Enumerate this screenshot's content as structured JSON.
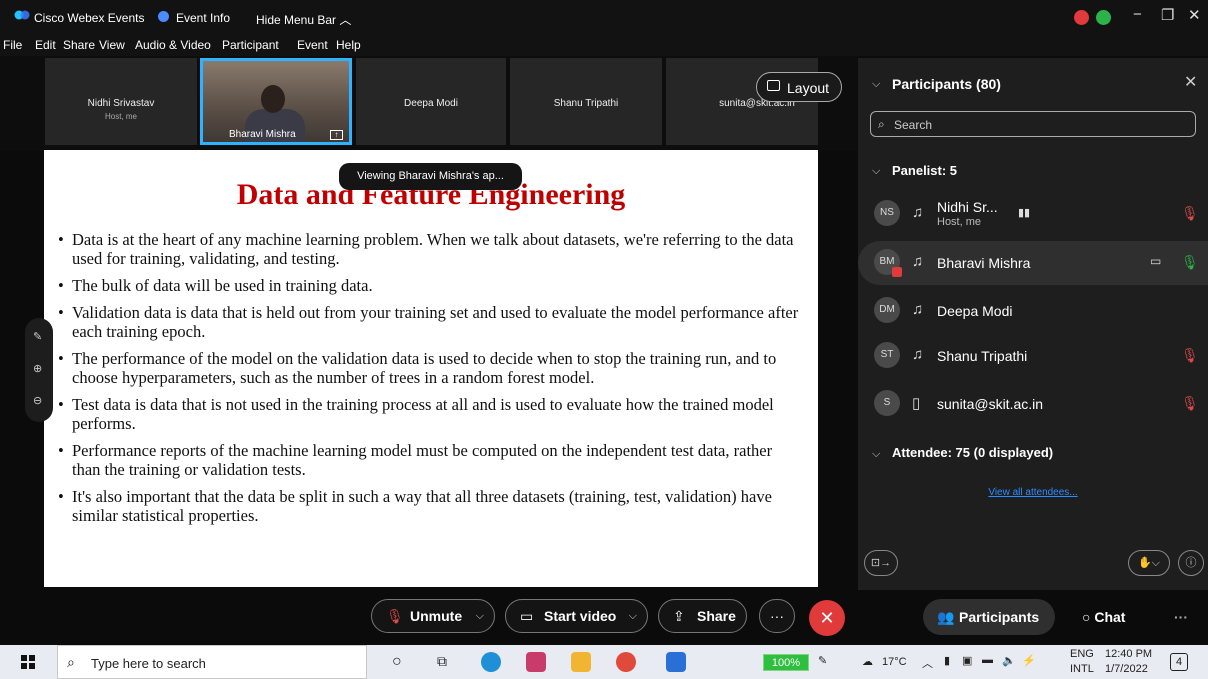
{
  "titlebar": {
    "app_name": "Cisco Webex Events",
    "event_info": "Event Info",
    "hide_menu": "Hide Menu Bar ︿",
    "minimize": "−",
    "restore": "❐",
    "close": "✕"
  },
  "menu": [
    "File",
    "Edit",
    "Share",
    "View",
    "Audio & Video",
    "Participant",
    "Event",
    "Help"
  ],
  "strip": {
    "tiles": [
      {
        "name": "Nidhi Srivastav",
        "sub": "Host, me"
      },
      {
        "name": "Bharavi Mishra",
        "sub": ""
      },
      {
        "name": "Deepa Modi",
        "sub": ""
      },
      {
        "name": "Shanu Tripathi",
        "sub": ""
      },
      {
        "name": "sunita@skit.ac.in",
        "sub": ""
      }
    ],
    "layout_label": "Layout"
  },
  "toast": "Viewing Bharavi Mishra's ap...",
  "slide": {
    "title": "Data and Feature Engineering",
    "bullets": [
      "Data is at the heart of any machine learning problem. When we talk about datasets, we're referring to the data used for training, validating, and testing.",
      "The bulk of data will be used in training data.",
      "Validation data is data that is held out from your training set and used to evaluate the model performance after each training epoch.",
      "The performance of the model on the validation data is used to decide when to stop the training run, and to choose hyperparameters, such as the number of trees in a random forest model.",
      "Test data is data that is not used in the training process at all and is used to evaluate how the trained model performs.",
      "Performance reports of the machine learning model must be computed on the independent test data, rather than the training or validation tests.",
      "It's also important that the data be split in such a way that all three datasets (training, test, validation) have similar statistical properties."
    ]
  },
  "panel": {
    "title": "Participants (80)",
    "search_placeholder": "Search",
    "panelist_header": "Panelist: 5",
    "panelists": [
      {
        "initials": "NS",
        "name": "Nidhi Sr...",
        "role": "Host, me"
      },
      {
        "initials": "BM",
        "name": "Bharavi Mishra",
        "role": ""
      },
      {
        "initials": "DM",
        "name": "Deepa Modi",
        "role": ""
      },
      {
        "initials": "ST",
        "name": "Shanu Tripathi",
        "role": ""
      },
      {
        "initials": "S",
        "name": "sunita@skit.ac.in",
        "role": ""
      }
    ],
    "attendee_header": "Attendee: 75 (0 displayed)",
    "view_all": "View all attendees..."
  },
  "controls": {
    "unmute": "Unmute",
    "start_video": "Start video",
    "share": "Share",
    "more": "···",
    "participants": "Participants",
    "chat": "Chat"
  },
  "taskbar": {
    "search_placeholder": "Type here to search",
    "battery": "100%",
    "temperature": "17°C",
    "lang1": "ENG",
    "lang2": "INTL",
    "time": "12:40 PM",
    "date": "1/7/2022",
    "notifications": "4"
  },
  "colors": {
    "accent": "#2db3ff",
    "slide_title": "#c00000",
    "leave": "#e03a3a",
    "link": "#2d8cff"
  }
}
